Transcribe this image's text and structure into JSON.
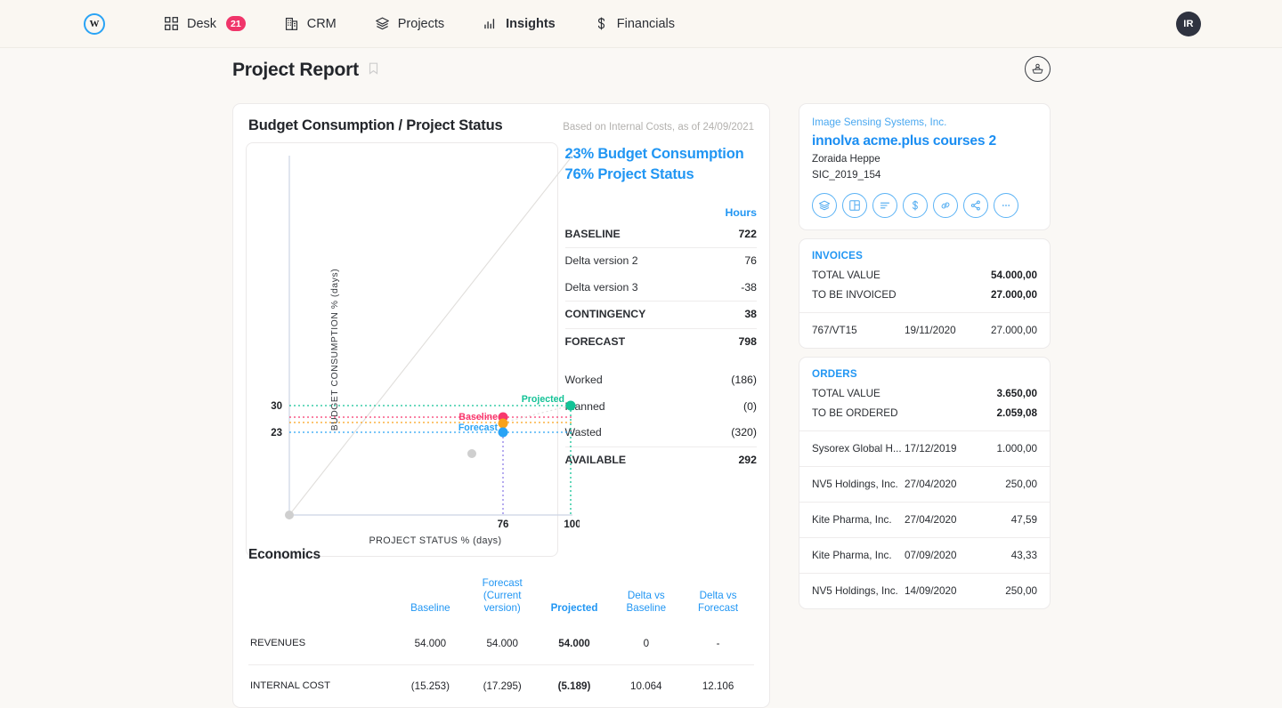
{
  "nav": {
    "logo_letter": "W",
    "items": [
      {
        "label": "Desk",
        "icon": "grid-icon",
        "badge": "21",
        "active": false
      },
      {
        "label": "CRM",
        "icon": "building-icon",
        "badge": null,
        "active": false
      },
      {
        "label": "Projects",
        "icon": "layers-icon",
        "badge": null,
        "active": false
      },
      {
        "label": "Insights",
        "icon": "bar-chart-icon",
        "badge": null,
        "active": true
      },
      {
        "label": "Financials",
        "icon": "dollar-icon",
        "badge": null,
        "active": false
      }
    ],
    "avatar_initials": "IR"
  },
  "page": {
    "title": "Project Report",
    "bookmark_icon": "bookmark-icon",
    "action_icon": "user-card-icon"
  },
  "budget_card": {
    "title": "Budget Consumption / Project Status",
    "subtitle": "Based on Internal Costs, as of 24/09/2021",
    "headline_1": "23% Budget Consumption",
    "headline_2": "76% Project Status",
    "hours_header": "Hours",
    "rows": [
      {
        "label": "BASELINE",
        "value": "722",
        "bold": true,
        "rule": false,
        "gap_after": false
      },
      {
        "label": "Delta version 2",
        "value": "76",
        "bold": false,
        "rule": true,
        "gap_after": false
      },
      {
        "label": "Delta version 3",
        "value": "-38",
        "bold": false,
        "rule": false,
        "gap_after": false
      },
      {
        "label": "CONTINGENCY",
        "value": "38",
        "bold": true,
        "rule": true,
        "gap_after": false
      },
      {
        "label": "FORECAST",
        "value": "798",
        "bold": true,
        "rule": true,
        "gap_after": true
      },
      {
        "label": "Worked",
        "value": "(186)",
        "bold": false,
        "rule": false,
        "gap_after": false
      },
      {
        "label": "Planned",
        "value": "(0)",
        "bold": false,
        "rule": false,
        "gap_after": false
      },
      {
        "label": "Wasted",
        "value": "(320)",
        "bold": false,
        "rule": false,
        "gap_after": false
      },
      {
        "label": "AVAILABLE",
        "value": "292",
        "bold": true,
        "rule": true,
        "gap_after": false
      }
    ]
  },
  "chart_data": {
    "type": "scatter",
    "title": "Budget Consumption / Project Status",
    "xlabel": "PROJECT STATUS % (days)",
    "ylabel": "BUDGET CONSUMPTION % (days)",
    "xlim": [
      0,
      108
    ],
    "ylim": [
      0,
      108
    ],
    "xticks": [
      "76",
      "100"
    ],
    "xtick_values": [
      76,
      100
    ],
    "yticks": [
      "30",
      "23"
    ],
    "ytick_values": [
      30,
      23
    ],
    "grid": false,
    "reference_line": {
      "from": [
        0,
        0
      ],
      "to": [
        100,
        100
      ],
      "color": "#dedbd8",
      "label": "diagonal parity line"
    },
    "points": [
      {
        "name": "Baseline",
        "x": 76,
        "y": 26,
        "color": "#f8386d",
        "label": "Baseline",
        "label_color": "#f8386d"
      },
      {
        "name": "Unlabeled (orange)",
        "x": 76,
        "y": 24.8,
        "color": "#f9a21b",
        "label": "",
        "label_color": "#f9a21b"
      },
      {
        "name": "Forecast",
        "x": 76,
        "y": 23,
        "color": "#29a3f5",
        "label": "Forecast",
        "label_color": "#29a3f5"
      },
      {
        "name": "Projected",
        "x": 100,
        "y": 30,
        "color": "#13c296",
        "label": "Projected",
        "label_color": "#13c296"
      },
      {
        "name": "Worked",
        "x": 61,
        "y": 17,
        "color": "#cfcfcf",
        "label": "",
        "label_color": "#cfcfcf"
      },
      {
        "name": "Origin",
        "x": 0,
        "y": 0,
        "color": "#cfcfcf",
        "label": "",
        "label_color": "#cfcfcf"
      }
    ],
    "dotted_guides": [
      {
        "y": 30,
        "color": "#13c296"
      },
      {
        "y": 26,
        "color": "#f8386d"
      },
      {
        "y": 24.8,
        "color": "#f9a21b"
      },
      {
        "y": 23,
        "color": "#29a3f5"
      },
      {
        "x": 76,
        "color": "#8f7fe8"
      },
      {
        "x": 100,
        "color": "#13c296"
      }
    ]
  },
  "economics": {
    "title": "Economics",
    "columns": [
      {
        "label": "",
        "bold": false
      },
      {
        "label": "Baseline",
        "bold": false
      },
      {
        "label": "Forecast\n(Current version)",
        "bold": false
      },
      {
        "label": "Projected",
        "bold": true
      },
      {
        "label": "Delta vs\nBaseline",
        "bold": false
      },
      {
        "label": "Delta vs\nForecast",
        "bold": false
      }
    ],
    "rows": [
      {
        "label": "REVENUES",
        "values": [
          "54.000",
          "54.000",
          "54.000",
          "0",
          "-"
        ]
      },
      {
        "label": "INTERNAL COST",
        "values": [
          "(15.253)",
          "(17.295)",
          "(5.189)",
          "10.064",
          "12.106"
        ]
      }
    ]
  },
  "project_card": {
    "company": "Image Sensing Systems, Inc.",
    "name": "innolva acme.plus courses 2",
    "owner": "Zoraida Heppe",
    "code": "SIC_2019_154",
    "actions": [
      {
        "icon": "layers-icon",
        "name": "layers"
      },
      {
        "icon": "layout-icon",
        "name": "layout"
      },
      {
        "icon": "list-icon",
        "name": "list"
      },
      {
        "icon": "dollar-icon",
        "name": "costs"
      },
      {
        "icon": "link-icon",
        "name": "link"
      },
      {
        "icon": "share-icon",
        "name": "share"
      },
      {
        "icon": "more-icon",
        "name": "more"
      }
    ]
  },
  "invoices": {
    "heading": "INVOICES",
    "total_label": "TOTAL VALUE",
    "total_value": "54.000,00",
    "pending_label": "TO BE INVOICED",
    "pending_value": "27.000,00",
    "rows": [
      {
        "ref": "767/VT15",
        "date": "19/11/2020",
        "amount": "27.000,00"
      }
    ]
  },
  "orders": {
    "heading": "ORDERS",
    "total_label": "TOTAL VALUE",
    "total_value": "3.650,00",
    "pending_label": "TO BE ORDERED",
    "pending_value": "2.059,08",
    "rows": [
      {
        "ref": "Sysorex Global H...",
        "date": "17/12/2019",
        "amount": "1.000,00"
      },
      {
        "ref": "NV5 Holdings, Inc.",
        "date": "27/04/2020",
        "amount": "250,00"
      },
      {
        "ref": "Kite Pharma, Inc.",
        "date": "27/04/2020",
        "amount": "47,59"
      },
      {
        "ref": "Kite Pharma, Inc.",
        "date": "07/09/2020",
        "amount": "43,33"
      },
      {
        "ref": "NV5 Holdings, Inc.",
        "date": "14/09/2020",
        "amount": "250,00"
      }
    ]
  },
  "colors": {
    "accent_blue": "#2196f3",
    "badge_pink": "#f0356a",
    "background": "#faf8f5"
  }
}
